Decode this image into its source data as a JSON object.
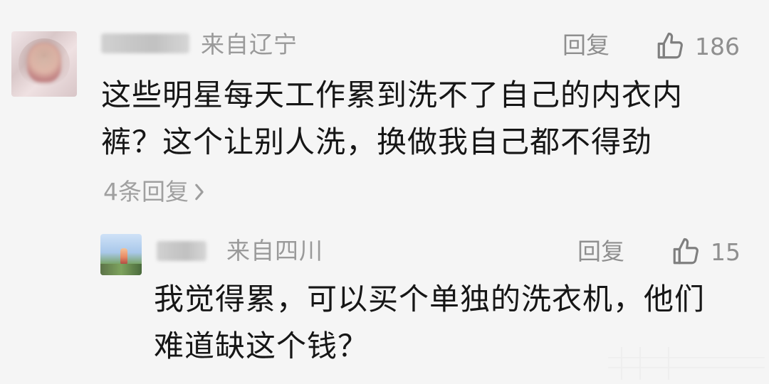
{
  "main_comment": {
    "username_visible": "",
    "origin": "来自辽宁",
    "reply_label": "回复",
    "like_count": "186",
    "content": "这些明星每天工作累到洗不了自己的内衣内\n裤？这个让别人洗，换做我自己都不得劲",
    "more_replies": "4条回复"
  },
  "reply_comment": {
    "username_visible": "",
    "origin": "来自四川",
    "reply_label": "回复",
    "like_count": "15",
    "content": "我觉得累，可以买个单独的洗衣机，他们\n难道缺这个钱？"
  },
  "icons": {
    "like": "thumbs-up-icon",
    "chevron": "chevron-right-icon"
  },
  "colors": {
    "background": "#f5f5f5",
    "primary_text": "#161616",
    "secondary_text": "#9a9a9a"
  }
}
